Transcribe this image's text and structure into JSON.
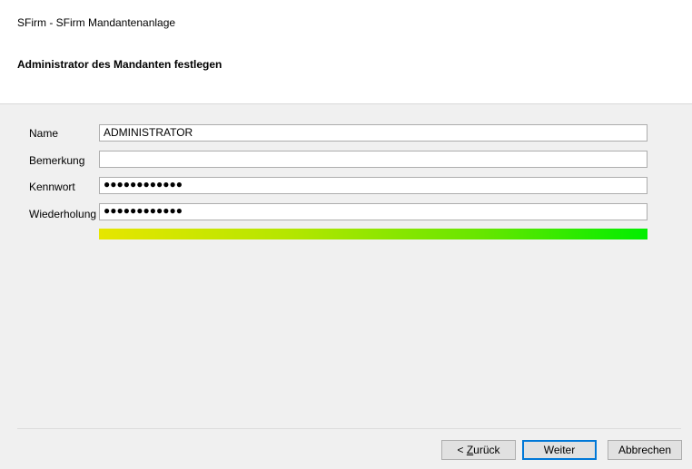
{
  "window": {
    "title": "SFirm - SFirm Mandantenanlage"
  },
  "header": {
    "title": "Administrator des Mandanten festlegen"
  },
  "form": {
    "name_label": "Name",
    "name_value": "ADMINISTRATOR",
    "bemerkung_label": "Bemerkung",
    "bemerkung_value": "",
    "kennwort_label": "Kennwort",
    "kennwort_value": "●●●●●●●●●●●●",
    "wiederholung_label": "Wiederholung",
    "wiederholung_value": "●●●●●●●●●●●●",
    "password_strength": 1.0
  },
  "buttons": {
    "back_prefix": "< ",
    "back_accel": "Z",
    "back_rest": "urück",
    "next_label": "Weiter",
    "cancel_label": "Abbrechen"
  },
  "colors": {
    "strength_start": "#e6e600",
    "strength_end": "#00ee00",
    "primary_border": "#0078d7"
  }
}
